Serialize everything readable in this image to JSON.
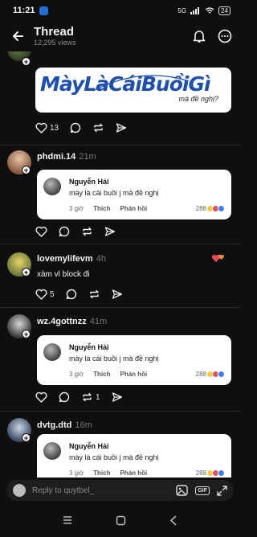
{
  "status": {
    "time": "11:21",
    "battery": "24",
    "network": "5G"
  },
  "header": {
    "title": "Thread",
    "views": "12,295 views"
  },
  "posts": [
    {
      "likes": "13",
      "banner_text": "MàyLàCáiBuồiGì",
      "banner_sub": "mà đề nghị?"
    },
    {
      "username": "phdmi.14",
      "time": "21m"
    },
    {
      "username": "lovemylifevm",
      "time": "4h",
      "text": "xàm vl block đi",
      "likes": "5"
    },
    {
      "username": "wz.4gottnzz",
      "time": "41m",
      "reposts": "1"
    },
    {
      "username": "dvtg.dtd",
      "time": "16m"
    }
  ],
  "quote": {
    "name": "Nguyễn Hải",
    "text": "mày là cái buồi j mà đề nghị",
    "time": "3 giờ",
    "like": "Thích",
    "reply": "Phản hồi",
    "count": "288"
  },
  "composer": {
    "placeholder": "Reply to quytbel_",
    "gif": "GIF"
  },
  "colors": {
    "background": "#0f0f0f",
    "brand": "#1d4fb0"
  }
}
